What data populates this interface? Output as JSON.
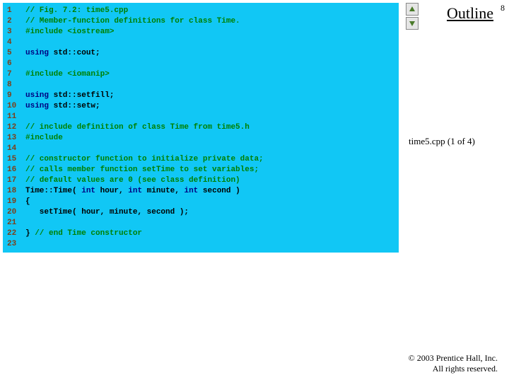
{
  "page_number": "8",
  "outline_label": "Outline",
  "slide_subtitle": "time5.cpp (1 of 4)",
  "copyright_line1": "© 2003 Prentice Hall, Inc.",
  "copyright_line2": "All rights reserved.",
  "code": {
    "lines": [
      {
        "n": "1",
        "segments": [
          {
            "cls": "cmt",
            "t": "// Fig. 7.2: time5.cpp"
          }
        ]
      },
      {
        "n": "2",
        "segments": [
          {
            "cls": "cmt",
            "t": "// Member-function definitions for class Time."
          }
        ]
      },
      {
        "n": "3",
        "segments": [
          {
            "cls": "pp",
            "t": "#include <iostream>"
          }
        ]
      },
      {
        "n": "4",
        "segments": []
      },
      {
        "n": "5",
        "segments": [
          {
            "cls": "kw",
            "t": "using "
          },
          {
            "cls": "tok",
            "t": "std::cout;"
          }
        ]
      },
      {
        "n": "6",
        "segments": []
      },
      {
        "n": "7",
        "segments": [
          {
            "cls": "pp",
            "t": "#include <iomanip>"
          }
        ]
      },
      {
        "n": "8",
        "segments": []
      },
      {
        "n": "9",
        "segments": [
          {
            "cls": "kw",
            "t": "using "
          },
          {
            "cls": "tok",
            "t": "std::setfill;"
          }
        ]
      },
      {
        "n": "10",
        "segments": [
          {
            "cls": "kw",
            "t": "using "
          },
          {
            "cls": "tok",
            "t": "std::setw;"
          }
        ]
      },
      {
        "n": "11",
        "segments": []
      },
      {
        "n": "12",
        "segments": [
          {
            "cls": "cmt",
            "t": "// include definition of class Time from time5.h"
          }
        ]
      },
      {
        "n": "13",
        "segments": [
          {
            "cls": "pp",
            "t": "#include"
          }
        ]
      },
      {
        "n": "14",
        "segments": []
      },
      {
        "n": "15",
        "segments": [
          {
            "cls": "cmt",
            "t": "// constructor function to initialize private data;"
          }
        ]
      },
      {
        "n": "16",
        "segments": [
          {
            "cls": "cmt",
            "t": "// calls member function setTime to set variables;"
          }
        ]
      },
      {
        "n": "17",
        "segments": [
          {
            "cls": "cmt",
            "t": "// default values are 0 (see class definition)"
          }
        ]
      },
      {
        "n": "18",
        "segments": [
          {
            "cls": "tok",
            "t": "Time::Time( "
          },
          {
            "cls": "kw",
            "t": "int"
          },
          {
            "cls": "tok",
            "t": " hour, "
          },
          {
            "cls": "kw",
            "t": "int"
          },
          {
            "cls": "tok",
            "t": " minute, "
          },
          {
            "cls": "kw",
            "t": "int"
          },
          {
            "cls": "tok",
            "t": " second )"
          }
        ]
      },
      {
        "n": "19",
        "segments": [
          {
            "cls": "tok",
            "t": "{"
          }
        ]
      },
      {
        "n": "20",
        "segments": [
          {
            "cls": "tok",
            "t": "   setTime( hour, minute, second );"
          }
        ]
      },
      {
        "n": "21",
        "segments": []
      },
      {
        "n": "22",
        "segments": [
          {
            "cls": "tok",
            "t": "} "
          },
          {
            "cls": "cmt",
            "t": "// end Time constructor"
          }
        ]
      },
      {
        "n": "23",
        "segments": []
      }
    ]
  }
}
